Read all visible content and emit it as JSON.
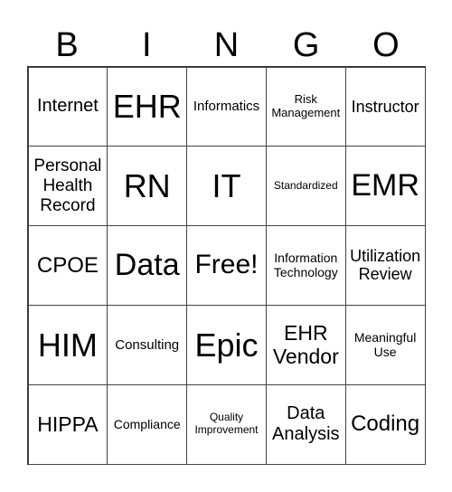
{
  "header": [
    "B",
    "I",
    "N",
    "G",
    "O"
  ],
  "cells": [
    "Internet",
    "EHR",
    "Informatics",
    "Risk Management",
    "Instructor",
    "Personal Health Record",
    "RN",
    "IT",
    "Standardized",
    "EMR",
    "CPOE",
    "Data",
    "Free!",
    "Information Technology",
    "Utilization Review",
    "HIM",
    "Consulting",
    "Epic",
    "EHR Vendor",
    "Meaningful Use",
    "HIPPA",
    "Compliance",
    "Quality Improvement",
    "Data Analysis",
    "Coding"
  ]
}
